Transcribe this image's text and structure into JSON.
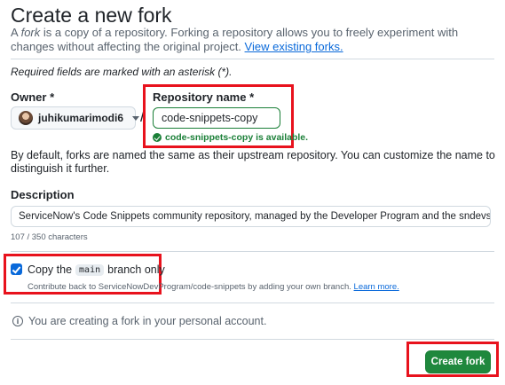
{
  "header": {
    "title": "Create a new fork",
    "intro_prefix": "A ",
    "intro_em": "fork",
    "intro_rest": " is a copy of a repository. Forking a repository allows you to freely experiment with changes without affecting the original project. ",
    "view_forks_link": "View existing forks."
  },
  "form": {
    "required_note": "Required fields are marked with an asterisk (*).",
    "owner": {
      "label": "Owner *",
      "value": "juhikumarimodi6",
      "icon": "caret-down-icon"
    },
    "separator": "/",
    "repo_name": {
      "label": "Repository name *",
      "value": "code-snippets-copy",
      "availability": "code-snippets-copy is available.",
      "status_color": "#1a7f37"
    },
    "default_note": "By default, forks are named the same as their upstream repository. You can customize the name to distinguish it further.",
    "description": {
      "label": "Description",
      "value": "ServiceNow's Code Snippets community repository, managed by the Developer Program and the sndevs comm",
      "char_count": "107 / 350 characters"
    },
    "copy_branch": {
      "checked": true,
      "label_prefix": "Copy the",
      "branch": "main",
      "label_suffix": "branch only",
      "help_text": "Contribute back to ServiceNowDevProgram/code-snippets by adding your own branch.",
      "learn_more": "Learn more."
    },
    "info": "You are creating a fork in your personal account.",
    "submit_label": "Create fork"
  },
  "colors": {
    "primary_button": "#1f883d",
    "link": "#0969da",
    "highlight_box": "#e8121d"
  }
}
